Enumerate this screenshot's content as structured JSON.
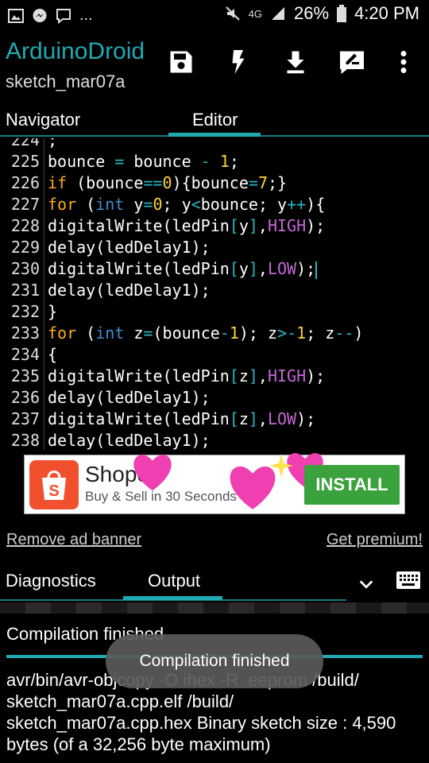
{
  "status_bar": {
    "network": "4G",
    "battery": "26%",
    "time": "4:20 PM",
    "ellipsis": "..."
  },
  "app": {
    "title": "ArduinoDroid",
    "subtitle": "sketch_mar07a",
    "toolbar_icons": [
      "save-icon",
      "flash-icon",
      "download-icon",
      "edit-icon",
      "more-vert-icon"
    ]
  },
  "tabs": {
    "navigator": "Navigator",
    "editor": "Editor",
    "active": "editor"
  },
  "editor": {
    "lines": [
      {
        "n": "224",
        "code": ";"
      },
      {
        "n": "225",
        "code": "bounce = bounce - 1;"
      },
      {
        "n": "226",
        "code": "if (bounce==0){bounce=7;}"
      },
      {
        "n": "227",
        "code": "for (int y=0; y<bounce; y++){"
      },
      {
        "n": "228",
        "code": "digitalWrite(ledPin[y],HIGH);"
      },
      {
        "n": "229",
        "code": "delay(ledDelay1);"
      },
      {
        "n": "230",
        "code": "digitalWrite(ledPin[y],LOW);"
      },
      {
        "n": "231",
        "code": "delay(ledDelay1);"
      },
      {
        "n": "232",
        "code": "}"
      },
      {
        "n": "233",
        "code": "for (int z=(bounce-1); z>-1; z--)"
      },
      {
        "n": "234",
        "code": "{"
      },
      {
        "n": "235",
        "code": "digitalWrite(ledPin[z],HIGH);"
      },
      {
        "n": "236",
        "code": "delay(ledDelay1);"
      },
      {
        "n": "237",
        "code": "digitalWrite(ledPin[z],LOW);"
      },
      {
        "n": "238",
        "code": "delay(ledDelay1);"
      }
    ]
  },
  "ad": {
    "brand": "Shopee",
    "tagline": "Buy & Sell in 30 Seconds",
    "button": "INSTALL"
  },
  "links": {
    "remove_ad": "Remove ad banner",
    "premium": "Get premium!"
  },
  "bottom_tabs": {
    "diagnostics": "Diagnostics",
    "output": "Output",
    "active": "output"
  },
  "output": {
    "status": "Compilation finished",
    "text": "avr/bin/avr-objcopy -O ihex -R .eeprom /build/ sketch_mar07a.cpp.elf /build/ sketch_mar07a.cpp.hex Binary sketch size : 4,590 bytes (of a 32,256 byte maximum)"
  },
  "toast": "Compilation finished",
  "colors": {
    "accent": "#1faab3",
    "keyword": "#ffa825",
    "type": "#3d8fd6",
    "number": "#ffd23b",
    "constant": "#c567d6"
  }
}
